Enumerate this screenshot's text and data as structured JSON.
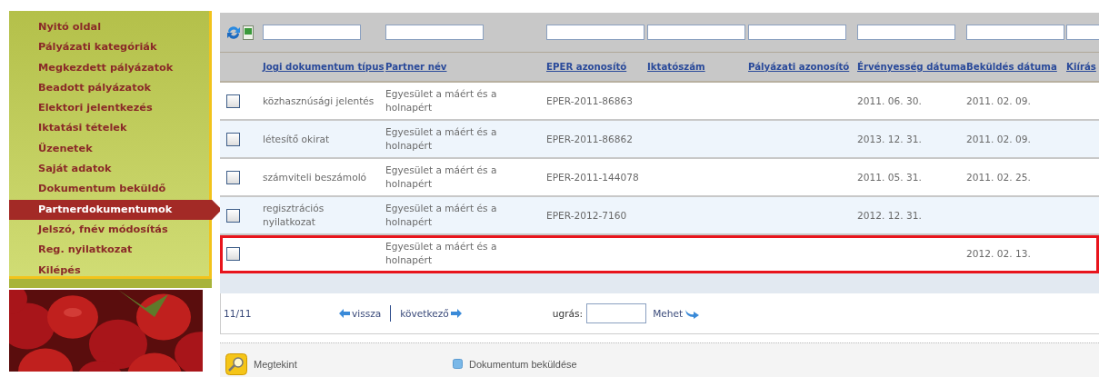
{
  "sidebar": {
    "items": [
      {
        "label": "Nyitó oldal",
        "selected": false
      },
      {
        "label": "Pályázati kategóriák",
        "selected": false
      },
      {
        "label": "Megkezdett pályázatok",
        "selected": false
      },
      {
        "label": "Beadott pályázatok",
        "selected": false
      },
      {
        "label": "Elektori jelentkezés",
        "selected": false
      },
      {
        "label": "Iktatási tételek",
        "selected": false
      },
      {
        "label": "Üzenetek",
        "selected": false
      },
      {
        "label": "Saját adatok",
        "selected": false
      },
      {
        "label": "Dokumentum beküldő",
        "selected": false
      },
      {
        "label": "Partnerdokumentumok",
        "selected": true
      },
      {
        "label": "Jelszó, fnév módosítás",
        "selected": false
      },
      {
        "label": "Reg. nyilatkozat",
        "selected": false
      },
      {
        "label": "Kilépés",
        "selected": false
      }
    ]
  },
  "table": {
    "columns": [
      "Jogi dokumentum típus",
      "Partner név",
      "EPER azonosító",
      "Iktatószám",
      "Pályázati azonosító",
      "Érvényesség dátuma",
      "Beküldés dátuma",
      "Kiírás"
    ],
    "rows": [
      {
        "checked": false,
        "highlighted": false,
        "cells": [
          "közhasznúsági jelentés",
          "Egyesület a máért és a holnapért",
          "EPER-2011-86863",
          "",
          "",
          "2011. 06. 30.",
          "2011. 02. 09.",
          ""
        ]
      },
      {
        "checked": false,
        "highlighted": false,
        "cells": [
          "létesítő okirat",
          "Egyesület a máért és a holnapért",
          "EPER-2011-86862",
          "",
          "",
          "2013. 12. 31.",
          "2011. 02. 09.",
          ""
        ]
      },
      {
        "checked": false,
        "highlighted": false,
        "cells": [
          "számviteli beszámoló",
          "Egyesület a máért és a holnapért",
          "EPER-2011-144078",
          "",
          "",
          "2011. 05. 31.",
          "2011. 02. 25.",
          ""
        ]
      },
      {
        "checked": false,
        "highlighted": false,
        "cells": [
          "regisztrációs nyilatkozat",
          "Egyesület a máért és a holnapért",
          "EPER-2012-7160",
          "",
          "",
          "2012. 12. 31.",
          "",
          ""
        ]
      },
      {
        "checked": false,
        "highlighted": true,
        "cells": [
          "",
          "Egyesület a máért és a holnapért",
          "",
          "",
          "",
          "",
          "2012. 02. 13.",
          ""
        ]
      }
    ]
  },
  "pager": {
    "count": "11/11",
    "previous": "vissza",
    "next": "következő",
    "jump_label": "ugrás:",
    "go": "Mehet"
  },
  "actions": [
    {
      "kind": "view",
      "label": "Megtekint"
    },
    {
      "kind": "send",
      "label": "Dokumentum beküldése"
    }
  ]
}
